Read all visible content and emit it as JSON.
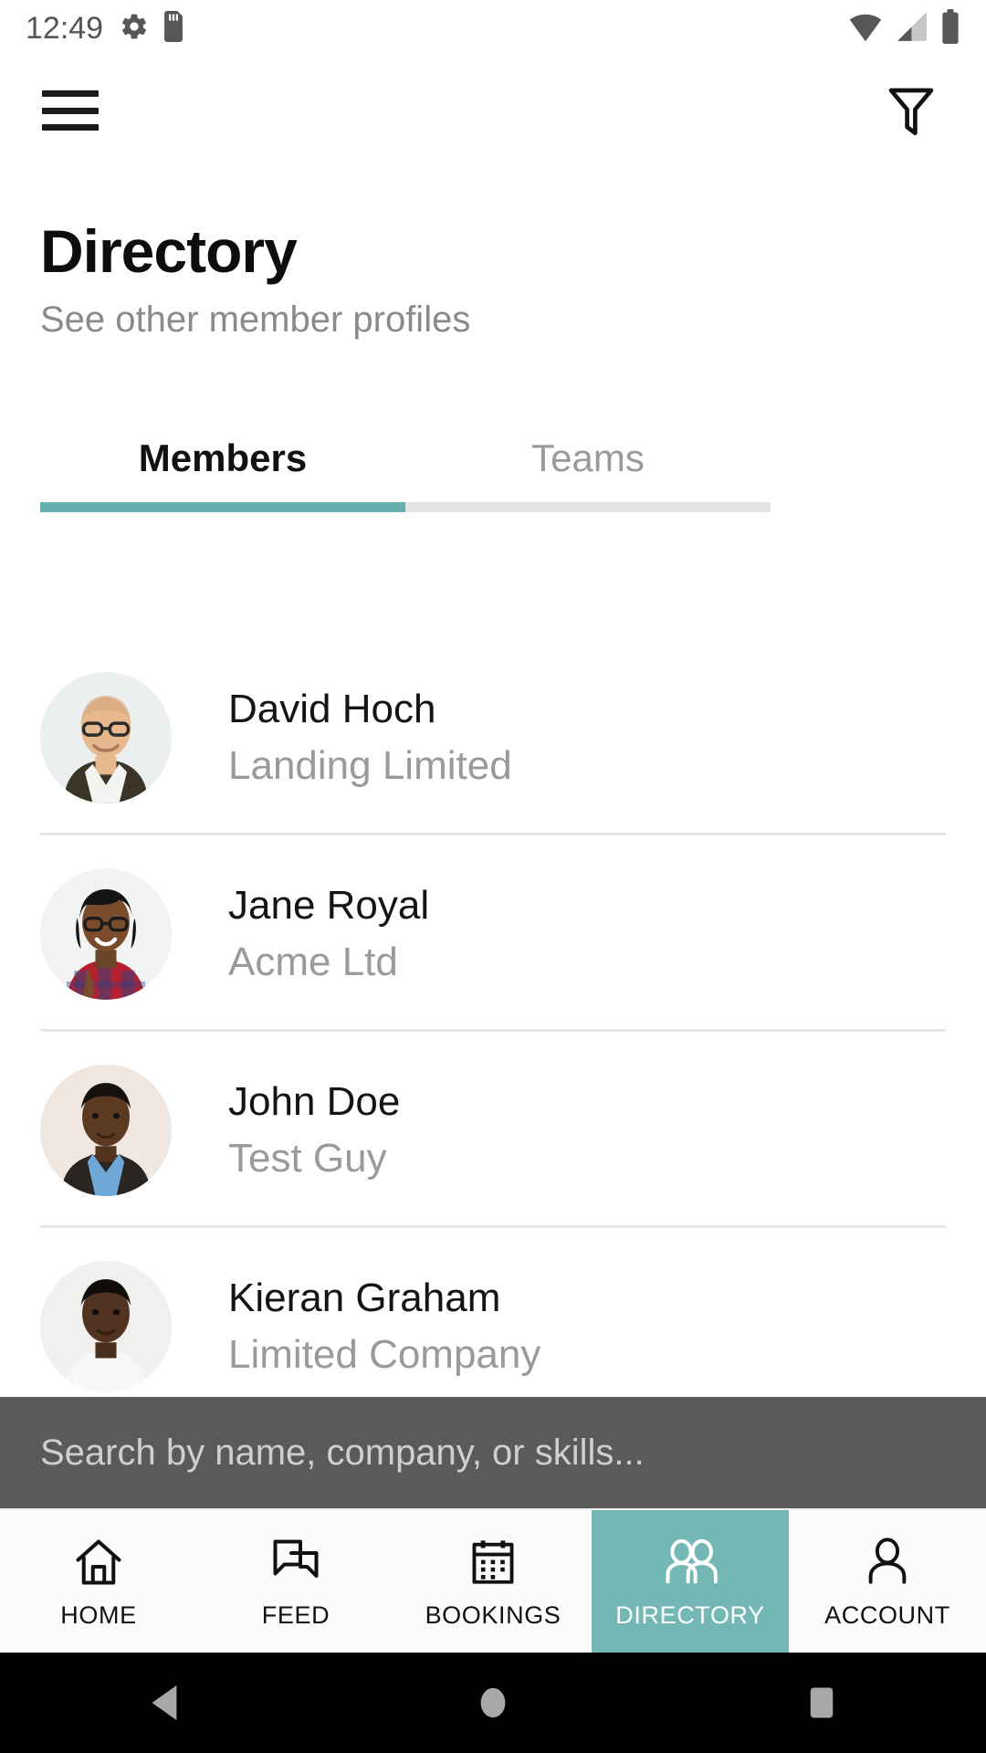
{
  "statusbar": {
    "time": "12:49",
    "left_icons": [
      "gear-icon",
      "sd-card-icon"
    ],
    "right_icons": [
      "wifi-icon",
      "cellular-signal-icon",
      "battery-icon"
    ]
  },
  "appbar": {
    "menu_icon": "hamburger-menu-icon",
    "filter_icon": "filter-funnel-icon"
  },
  "header": {
    "title": "Directory",
    "subtitle": "See other member profiles"
  },
  "tabs": {
    "active_index": 0,
    "items": [
      {
        "label": "Members"
      },
      {
        "label": "Teams"
      }
    ],
    "indicator_color": "#63b0af",
    "track_color": "#e3e3e3"
  },
  "search": {
    "placeholder": "Search by name, company, or skills..."
  },
  "members": [
    {
      "name": "David Hoch",
      "company": "Landing Limited",
      "avatar": "male-bald-glasses"
    },
    {
      "name": "Jane Royal",
      "company": "Acme Ltd",
      "avatar": "female-glasses-plaid"
    },
    {
      "name": "John Doe",
      "company": "Test Guy",
      "avatar": "male-suit-blue-shirt"
    },
    {
      "name": "Kieran Graham",
      "company": "Limited Company",
      "avatar": "male-white-shirt"
    }
  ],
  "bottom_nav": {
    "active_index": 3,
    "active_bg": "#74b8b6",
    "items": [
      {
        "label": "HOME",
        "icon": "home-icon"
      },
      {
        "label": "FEED",
        "icon": "chat-bubbles-icon"
      },
      {
        "label": "BOOKINGS",
        "icon": "calendar-icon"
      },
      {
        "label": "DIRECTORY",
        "icon": "people-icon"
      },
      {
        "label": "ACCOUNT",
        "icon": "person-icon"
      }
    ]
  },
  "android_nav": {
    "back": "back-triangle-icon",
    "home": "home-circle-icon",
    "recents": "recents-square-icon"
  }
}
